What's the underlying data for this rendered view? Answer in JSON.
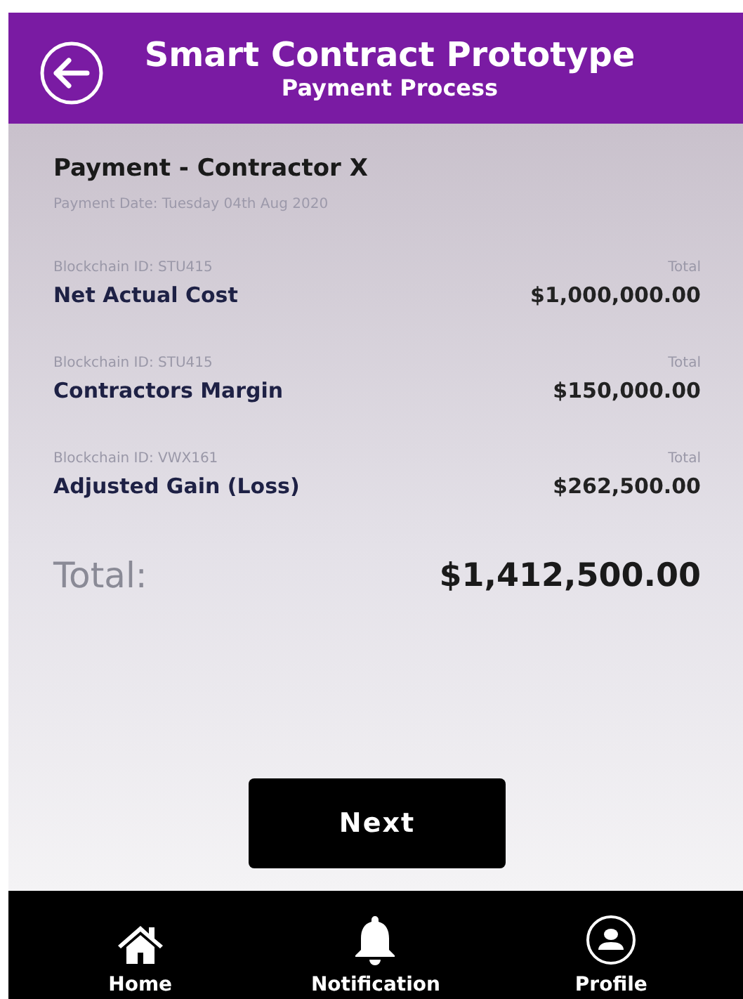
{
  "header": {
    "title": "Smart Contract Prototype",
    "subtitle": "Payment Process"
  },
  "payment": {
    "title": "Payment - Contractor X",
    "date": "Payment Date: Tuesday 04th Aug 2020"
  },
  "lines": [
    {
      "id": "Blockchain ID: STU415",
      "total_label": "Total",
      "name": "Net Actual Cost",
      "amount": "$1,000,000.00"
    },
    {
      "id": "Blockchain ID: STU415",
      "total_label": "Total",
      "name": "Contractors Margin",
      "amount": "$150,000.00"
    },
    {
      "id": "Blockchain ID: VWX161",
      "total_label": "Total",
      "name": "Adjusted Gain (Loss)",
      "amount": "$262,500.00"
    }
  ],
  "total": {
    "label": "Total:",
    "amount": "$1,412,500.00"
  },
  "next_button": "Next",
  "nav": [
    {
      "kind": "home",
      "label": "Home"
    },
    {
      "kind": "bell",
      "label": "Notification"
    },
    {
      "kind": "profile",
      "label": "Profile"
    }
  ]
}
